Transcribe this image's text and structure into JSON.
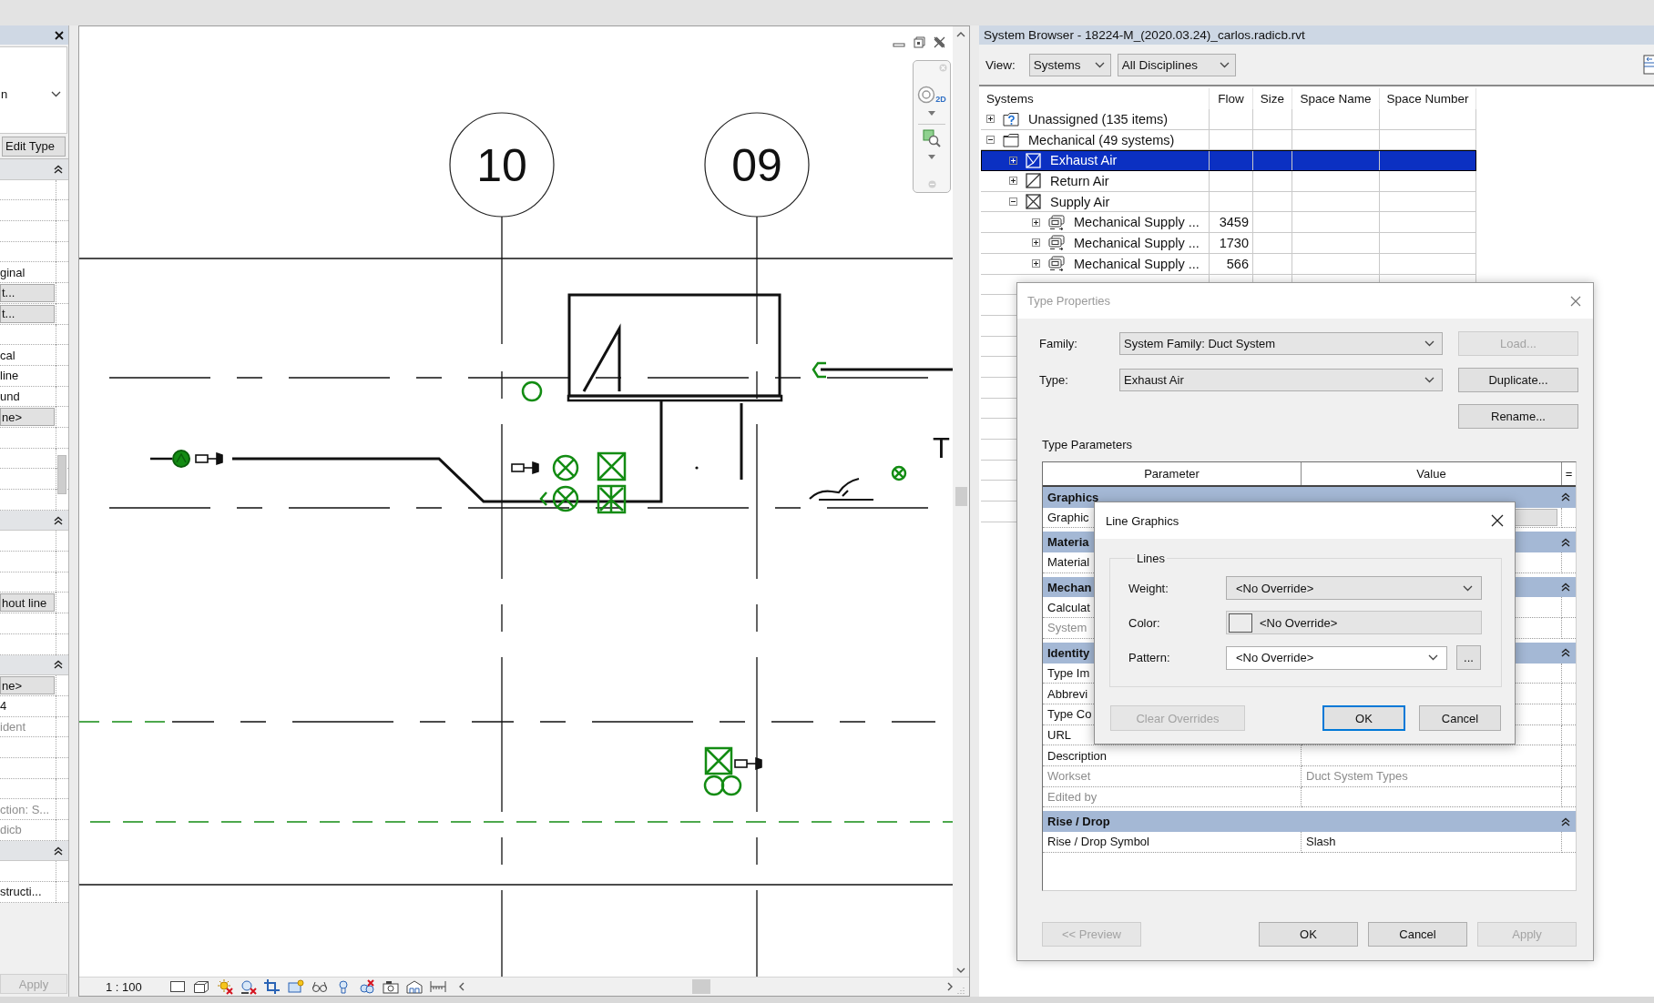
{
  "properties_panel": {
    "type_selector": "n",
    "edit_type": "Edit Type",
    "rows": [
      {
        "kind": "section",
        "expanded": true
      },
      {
        "kind": "empty"
      },
      {
        "kind": "empty"
      },
      {
        "kind": "empty"
      },
      {
        "kind": "empty"
      },
      {
        "kind": "value",
        "text": "ginal",
        "disabled": false
      },
      {
        "kind": "button",
        "text": "t..."
      },
      {
        "kind": "button",
        "text": "t..."
      },
      {
        "kind": "empty"
      },
      {
        "kind": "value",
        "text": "cal",
        "disabled": false
      },
      {
        "kind": "value",
        "text": "line",
        "disabled": false
      },
      {
        "kind": "value",
        "text": "und",
        "disabled": false
      },
      {
        "kind": "button",
        "text": "ne>"
      },
      {
        "kind": "empty"
      },
      {
        "kind": "empty"
      },
      {
        "kind": "empty"
      },
      {
        "kind": "empty"
      },
      {
        "kind": "section",
        "expanded": true
      },
      {
        "kind": "empty"
      },
      {
        "kind": "empty"
      },
      {
        "kind": "empty"
      },
      {
        "kind": "button",
        "text": "hout line"
      },
      {
        "kind": "empty"
      },
      {
        "kind": "empty"
      },
      {
        "kind": "section",
        "expanded": true
      },
      {
        "kind": "button",
        "text": "ne>"
      },
      {
        "kind": "value",
        "text": "4",
        "disabled": false
      },
      {
        "kind": "value",
        "text": "ident",
        "disabled": true
      },
      {
        "kind": "empty"
      },
      {
        "kind": "empty"
      },
      {
        "kind": "empty"
      },
      {
        "kind": "value",
        "text": "ction: S...",
        "disabled": true
      },
      {
        "kind": "value",
        "text": "dicb",
        "disabled": true
      },
      {
        "kind": "section",
        "expanded": true
      },
      {
        "kind": "empty"
      },
      {
        "kind": "value",
        "text": "structi...",
        "disabled": false
      }
    ],
    "apply": {
      "label": "Apply",
      "disabled": true
    }
  },
  "view": {
    "grid_bubbles": [
      "10",
      "09"
    ],
    "drawing_label": "T",
    "navigation_wheel_label": "2D",
    "scale": "1 : 100"
  },
  "system_browser": {
    "title": "System Browser - 18224-M_(2020.03.24)_carlos.radicb.rvt",
    "view_label": "View:",
    "dropdowns": [
      "Systems",
      "All Disciplines"
    ],
    "columns": [
      "Systems",
      "Flow",
      "Size",
      "Space Name",
      "Space Number"
    ],
    "tree": [
      {
        "label": "Unassigned (135 items)",
        "kind": "unassigned",
        "expanded": false,
        "selected": false
      },
      {
        "label": "Mechanical (49 systems)",
        "kind": "folder",
        "expanded": true,
        "selected": false,
        "children": [
          {
            "label": "Exhaust Air",
            "kind": "exhaust",
            "expanded": false,
            "selected": true
          },
          {
            "label": "Return Air",
            "kind": "return",
            "expanded": false,
            "selected": false
          },
          {
            "label": "Supply Air",
            "kind": "supply",
            "expanded": true,
            "selected": false,
            "children": [
              {
                "label": "Mechanical Supply ...",
                "kind": "system",
                "flow": "3459",
                "expanded": false,
                "selected": false
              },
              {
                "label": "Mechanical Supply ...",
                "kind": "system",
                "flow": "1730",
                "expanded": false,
                "selected": false
              },
              {
                "label": "Mechanical Supply ...",
                "kind": "system",
                "flow": "566",
                "expanded": false,
                "selected": false
              }
            ]
          }
        ]
      }
    ]
  },
  "type_properties": {
    "title": "Type Properties",
    "active": false,
    "family_label": "Family:",
    "family": "System Family: Duct System",
    "type_label": "Type:",
    "type": "Exhaust Air",
    "side_buttons": [
      {
        "label": "Load...",
        "disabled": true
      },
      {
        "label": "Duplicate...",
        "disabled": false
      },
      {
        "label": "Rename...",
        "disabled": false
      }
    ],
    "parameters_label": "Type Parameters",
    "columns": [
      "Parameter",
      "Value",
      "="
    ],
    "rows": [
      {
        "kind": "section",
        "label": "Graphics",
        "expanded": true
      },
      {
        "kind": "button",
        "label": "Graphic",
        "disabled": false
      },
      {
        "kind": "section",
        "label": "Materia",
        "expanded": true
      },
      {
        "kind": "param",
        "label": "Material",
        "disabled": false
      },
      {
        "kind": "section",
        "label": "Mechan",
        "expanded": true
      },
      {
        "kind": "param",
        "label": "Calculat",
        "disabled": false
      },
      {
        "kind": "param",
        "label": "System",
        "disabled": true
      },
      {
        "kind": "section",
        "label": "Identity",
        "expanded": true
      },
      {
        "kind": "param",
        "label": "Type Im",
        "disabled": false
      },
      {
        "kind": "param",
        "label": "Abbrevi",
        "disabled": false
      },
      {
        "kind": "param",
        "label": "Type Co",
        "disabled": false
      },
      {
        "kind": "param",
        "label": "URL",
        "disabled": false
      },
      {
        "kind": "param",
        "label": "Description",
        "disabled": false
      },
      {
        "kind": "param",
        "label": "Workset",
        "value": "Duct System Types",
        "disabled": true
      },
      {
        "kind": "param",
        "label": "Edited by",
        "disabled": true
      },
      {
        "kind": "section",
        "label": "Rise / Drop",
        "expanded": true
      },
      {
        "kind": "param",
        "label": "Rise / Drop Symbol",
        "value": "Slash",
        "disabled": false
      }
    ],
    "buttons": [
      {
        "label": "<< Preview",
        "disabled": true
      },
      {
        "label": "OK",
        "disabled": false
      },
      {
        "label": "Cancel",
        "disabled": false
      },
      {
        "label": "Apply",
        "disabled": true
      }
    ]
  },
  "line_graphics": {
    "title": "Line Graphics",
    "group_label": "Lines",
    "fields": [
      {
        "kind": "dropdown",
        "label": "Weight:",
        "value": "<No Override>"
      },
      {
        "kind": "color",
        "label": "Color:",
        "value": "<No Override>"
      },
      {
        "kind": "combo",
        "label": "Pattern:",
        "value": "<No Override>",
        "button": "..."
      }
    ],
    "buttons": [
      {
        "label": "Clear Overrides",
        "disabled": true,
        "default": false
      },
      {
        "label": "OK",
        "disabled": false,
        "default": true
      },
      {
        "label": "Cancel",
        "disabled": false,
        "default": false
      }
    ]
  }
}
